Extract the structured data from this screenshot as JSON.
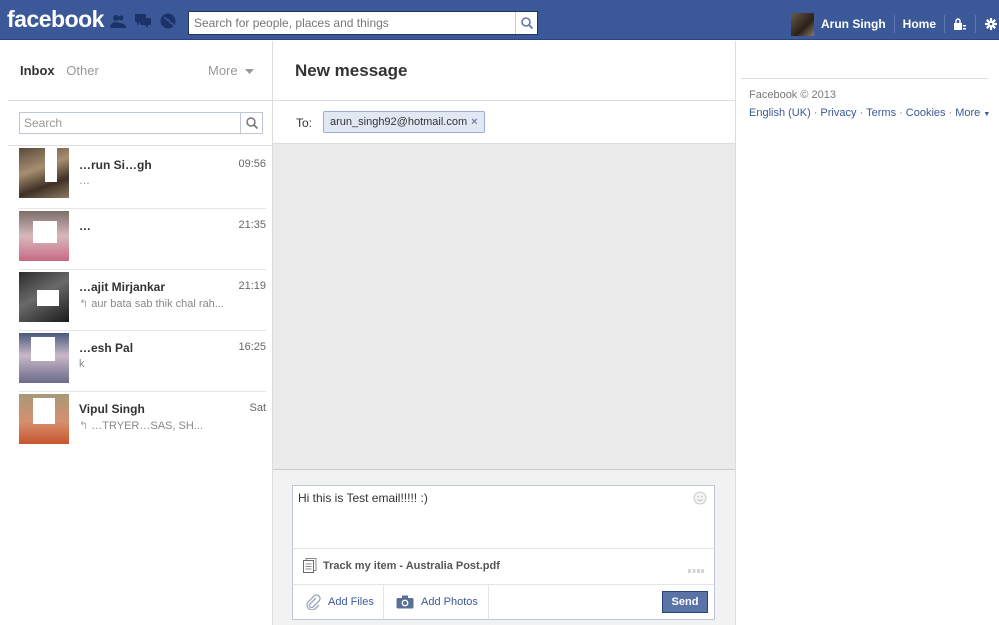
{
  "header": {
    "logo": "facebook",
    "search_placeholder": "Search for people, places and things",
    "user_name": "Arun Singh",
    "home_label": "Home"
  },
  "inbox": {
    "tab_inbox": "Inbox",
    "tab_other": "Other",
    "more_label": "More",
    "search_placeholder": "Search",
    "conversations": [
      {
        "name": "…run Si…gh",
        "snippet": "…",
        "time": "09:56"
      },
      {
        "name": "…",
        "snippet": "",
        "time": "21:35"
      },
      {
        "name": "…ajit Mirjankar",
        "snippet": "aur bata sab thik chal rah...",
        "time": "21:19"
      },
      {
        "name": "…esh Pal",
        "snippet": "k",
        "time": "16:25"
      },
      {
        "name": "Vipul Singh",
        "snippet": "…TRYER…SAS, SH...",
        "time": "Sat"
      }
    ]
  },
  "compose": {
    "title": "New message",
    "to_label": "To:",
    "recipient": "arun_singh92@hotmail.com",
    "body": "Hi this is Test email!!!!! :)",
    "attachment": "Track my item - Australia Post.pdf",
    "add_files": "Add Files",
    "add_photos": "Add Photos",
    "send": "Send"
  },
  "footer": {
    "copyright": "Facebook © 2013",
    "links": [
      "English (UK)",
      "Privacy",
      "Terms",
      "Cookies",
      "More"
    ]
  },
  "colors": {
    "brand_blue": "#3b5998",
    "send_button": "#5b74a8"
  }
}
